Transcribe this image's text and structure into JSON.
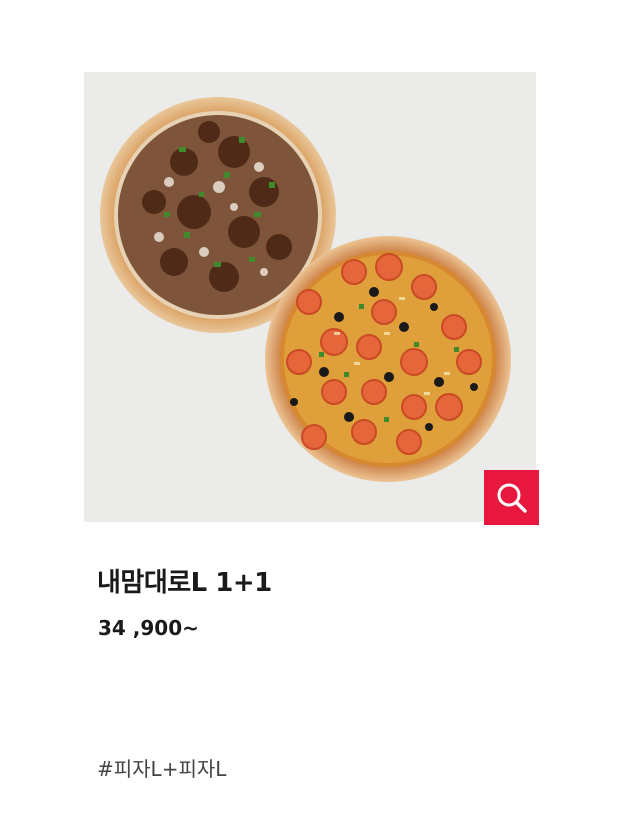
{
  "product": {
    "name": "내맘대로L 1+1",
    "price": "34 ,900~",
    "tag": "#피자L+피자L",
    "image_alt": "pizza-pair-photo"
  },
  "zoom_button": {
    "icon": "search-icon",
    "color": "#e8173d"
  },
  "colors": {
    "image_background": "#ebebea",
    "text_primary": "#1a1a1a",
    "text_secondary": "#444444"
  }
}
